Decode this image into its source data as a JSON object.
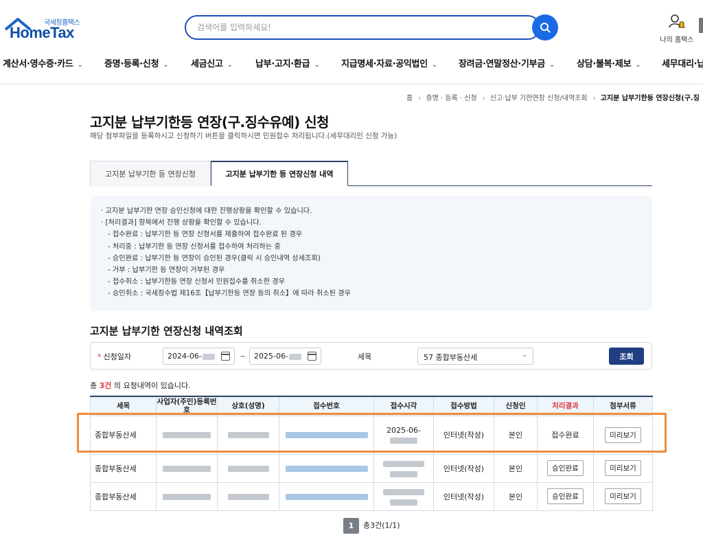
{
  "header": {
    "logo_sub": "국세청홈택스",
    "logo_main": "HomeTax",
    "search_placeholder": "검색어를 입력하세요!",
    "myhome_label": "나의 홈택스"
  },
  "nav": [
    "계산서·영수증·카드",
    "증명·등록·신청",
    "세금신고",
    "납부·고지·환급",
    "지급명세·자료·공익법인",
    "장려금·연말정산·기부금",
    "상담·불복·제보",
    "세무대리·납"
  ],
  "breadcrumb": [
    "홈",
    "증명 · 등록 · 신청",
    "신고·납부 기한연장 신청/내역조회",
    "고지분 납부기한등 연장신청(구.징"
  ],
  "page": {
    "title": "고지분 납부기한등 연장(구.징수유예) 신청",
    "desc": "해당 첨부파일을 등록하시고 신청하기 버튼을 클릭하시면 민원접수 처리됩니다.(세무대리인 신청 가능)"
  },
  "tabs": [
    "고지분 납부기한 등 연장신청",
    "고지분 납부기한 등 연장신청 내역"
  ],
  "notice": [
    "· 고지분 납부기한 연장 승인신청에 대한 진행상황을 확인할 수 있습니다.",
    "· [처리결과] 항목에서 진행 상황을 확인할 수 있습니다.",
    "- 접수완료 : 납부기한 등 연장 신청서를 제출하여 접수완료 된 경우",
    "- 처리중 : 납부기한 등 연장 신청서를 접수하여 처리하는 중",
    "- 승인완료 : 납부기한 등 연장이 승인된 경우(클릭 시 승인내역 상세조회)",
    "- 거부 : 납부기한 등 연장이 거부된 경우",
    "- 접수취소 : 납부기한등 연장 신청서 민원접수를 취소한 경우",
    "- 승인취소 : 국세징수법 제16조【납부기한등 연장 등의 취소】에 따라 취소된 경우"
  ],
  "section_title": "고지분 납부기한 연장신청 내역조회",
  "form": {
    "date_label": "신청일자",
    "date_from": "2024-06-",
    "date_to": "2025-06-",
    "tilde": "~",
    "tax_label": "세목",
    "tax_value": "57 종합부동산세",
    "query_button": "조회"
  },
  "count": {
    "prefix": "총 ",
    "num": "3건",
    "suffix": " 의 요청내역이 있습니다."
  },
  "table": {
    "headers": [
      "세목",
      "사업자(주민)등록번호",
      "상호(성명)",
      "접수번호",
      "접수시각",
      "접수방법",
      "신청인",
      "처리결과",
      "첨부서류"
    ],
    "rows": [
      {
        "tax": "종합부동산세",
        "time": "2025-06-",
        "method": "인터넷(작성)",
        "applicant": "본인",
        "result": "접수완료",
        "attach": "미리보기"
      },
      {
        "tax": "종합부동산세",
        "time": "",
        "method": "인터넷(작성)",
        "applicant": "본인",
        "result": "승인완료",
        "attach": "미리보기"
      },
      {
        "tax": "종합부동산세",
        "time": "",
        "method": "인터넷(작성)",
        "applicant": "본인",
        "result": "승인완료",
        "attach": "미리보기"
      }
    ]
  },
  "pager": {
    "current": "1",
    "summary": "총3건(1/1)"
  },
  "colors": {
    "accent": "#1f3f82",
    "search_border": "#1a4fb8",
    "highlight": "#f08a3a",
    "red": "#e0383e"
  }
}
